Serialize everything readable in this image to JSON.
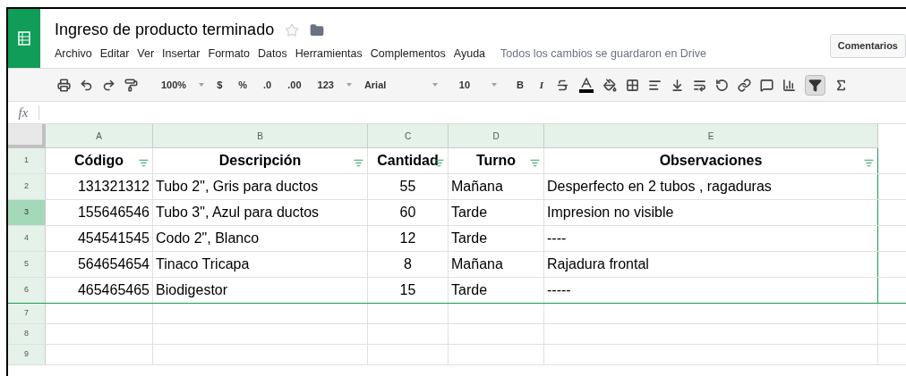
{
  "document": {
    "title": "Ingreso de producto terminado",
    "starred": false
  },
  "menu": [
    "Archivo",
    "Editar",
    "Ver",
    "Insertar",
    "Formato",
    "Datos",
    "Herramientas",
    "Complementos",
    "Ayuda"
  ],
  "save_status": "Todos los cambios se guardaron en Drive",
  "comments_button": "Comentarios",
  "toolbar": {
    "zoom": "100%",
    "currency": "$",
    "percent": "%",
    "decimal_less": ".0",
    "decimal_more": ".00",
    "number_format": "123",
    "font": "Arial",
    "font_size": "10",
    "bold": "B",
    "italic": "I",
    "filter_on": true
  },
  "formula_bar": {
    "fx": "fx"
  },
  "columns": [
    "A",
    "B",
    "C",
    "D",
    "E"
  ],
  "rows": [
    {
      "number": "1",
      "selected": false,
      "header": true,
      "cells": [
        "Código",
        "Descripción",
        "Cantidad",
        "Turno",
        "Observaciones"
      ]
    },
    {
      "number": "2",
      "selected": false,
      "header": false,
      "cells": [
        "131321312",
        "Tubo 2\", Gris para ductos",
        "55",
        "Mañana",
        "Desperfecto en 2 tubos , ragaduras"
      ]
    },
    {
      "number": "3",
      "selected": true,
      "header": false,
      "cells": [
        "155646546",
        "Tubo 3\", Azul para ductos",
        "60",
        "Tarde",
        "Impresion no visible"
      ]
    },
    {
      "number": "4",
      "selected": false,
      "header": false,
      "cells": [
        "454541545",
        "Codo 2\", Blanco",
        "12",
        "Tarde",
        "----"
      ]
    },
    {
      "number": "5",
      "selected": false,
      "header": false,
      "cells": [
        "564654654",
        "Tinaco Tricapa",
        "8",
        "Mañana",
        "Rajadura frontal"
      ]
    },
    {
      "number": "6",
      "selected": false,
      "header": false,
      "cells": [
        "465465465",
        "Biodigestor",
        "15",
        "Tarde",
        "-----"
      ]
    }
  ],
  "empty_rows": [
    "7",
    "8",
    "9"
  ]
}
